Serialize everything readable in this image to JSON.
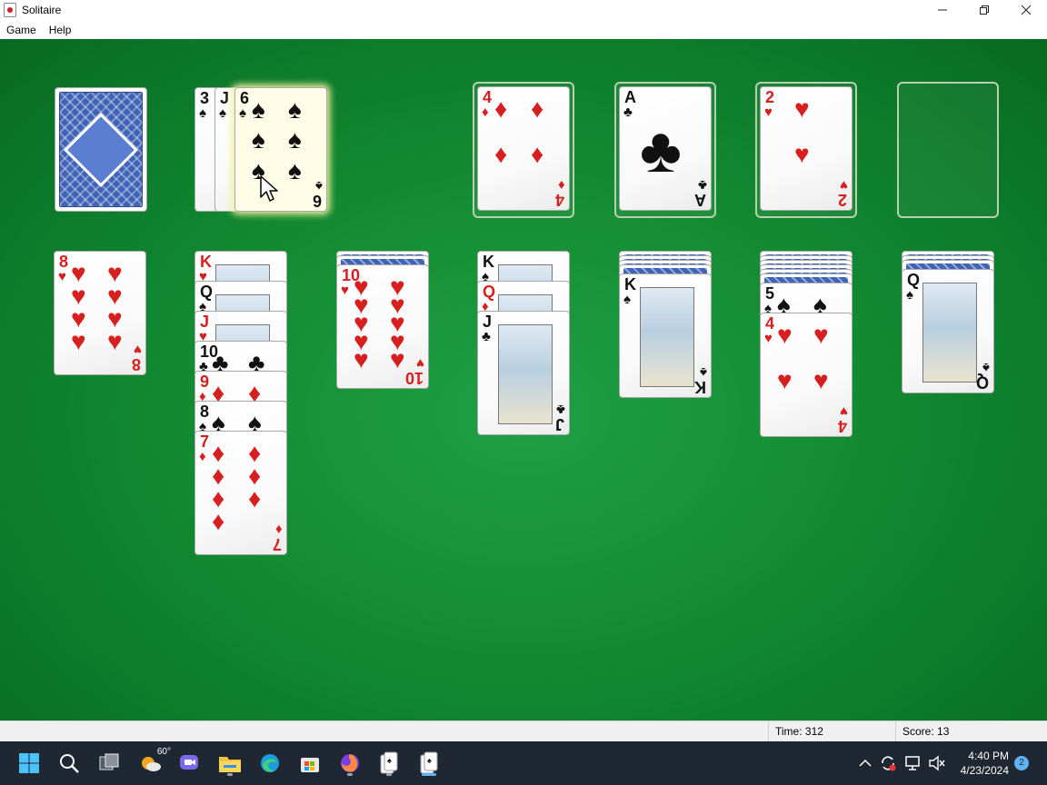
{
  "window": {
    "title": "Solitaire",
    "controls": {
      "minimize_icon": "minimize-icon",
      "restore_icon": "restore-icon",
      "close_icon": "close-icon"
    }
  },
  "menu": {
    "items": [
      "Game",
      "Help"
    ]
  },
  "colors": {
    "felt": "#169035",
    "card_red": "#d61f1f",
    "card_back": "#3f63b6"
  },
  "game": {
    "stock": {
      "face_down": true
    },
    "waste": [
      {
        "rank": "3",
        "suit": "♠",
        "color": "black"
      },
      {
        "rank": "J",
        "suit": "♠",
        "color": "black"
      },
      {
        "rank": "6",
        "suit": "♠",
        "color": "black",
        "selected": true
      }
    ],
    "foundations": [
      {
        "rank": "4",
        "suit": "♦",
        "color": "red"
      },
      {
        "rank": "A",
        "suit": "♣",
        "color": "black"
      },
      {
        "rank": "2",
        "suit": "♥",
        "color": "red"
      },
      {
        "rank": "",
        "suit": "",
        "color": ""
      }
    ],
    "tableau": [
      {
        "face_down": 0,
        "cards": [
          {
            "rank": "8",
            "suit": "♥",
            "color": "red"
          }
        ]
      },
      {
        "face_down": 0,
        "cards": [
          {
            "rank": "K",
            "suit": "♥",
            "color": "red"
          },
          {
            "rank": "Q",
            "suit": "♠",
            "color": "black"
          },
          {
            "rank": "J",
            "suit": "♥",
            "color": "red"
          },
          {
            "rank": "10",
            "suit": "♣",
            "color": "black"
          },
          {
            "rank": "9",
            "suit": "♦",
            "color": "red"
          },
          {
            "rank": "8",
            "suit": "♠",
            "color": "black"
          },
          {
            "rank": "7",
            "suit": "♦",
            "color": "red"
          }
        ]
      },
      {
        "face_down": 2,
        "cards": [
          {
            "rank": "10",
            "suit": "♥",
            "color": "red"
          }
        ]
      },
      {
        "face_down": 0,
        "cards": [
          {
            "rank": "K",
            "suit": "♠",
            "color": "black"
          },
          {
            "rank": "Q",
            "suit": "♦",
            "color": "red"
          },
          {
            "rank": "J",
            "suit": "♣",
            "color": "black"
          }
        ]
      },
      {
        "face_down": 4,
        "cards": [
          {
            "rank": "K",
            "suit": "♠",
            "color": "black"
          }
        ]
      },
      {
        "face_down": 6,
        "cards": [
          {
            "rank": "5",
            "suit": "♠",
            "color": "black"
          },
          {
            "rank": "4",
            "suit": "♥",
            "color": "red"
          }
        ]
      },
      {
        "face_down": 3,
        "cards": [
          {
            "rank": "Q",
            "suit": "♠",
            "color": "black"
          }
        ]
      }
    ]
  },
  "status": {
    "time": "Time:  312",
    "score": "Score: 13"
  },
  "taskbar": {
    "weather_temp": "60°",
    "time": "4:40 PM",
    "date": "4/23/2024",
    "notification_count": "2"
  }
}
